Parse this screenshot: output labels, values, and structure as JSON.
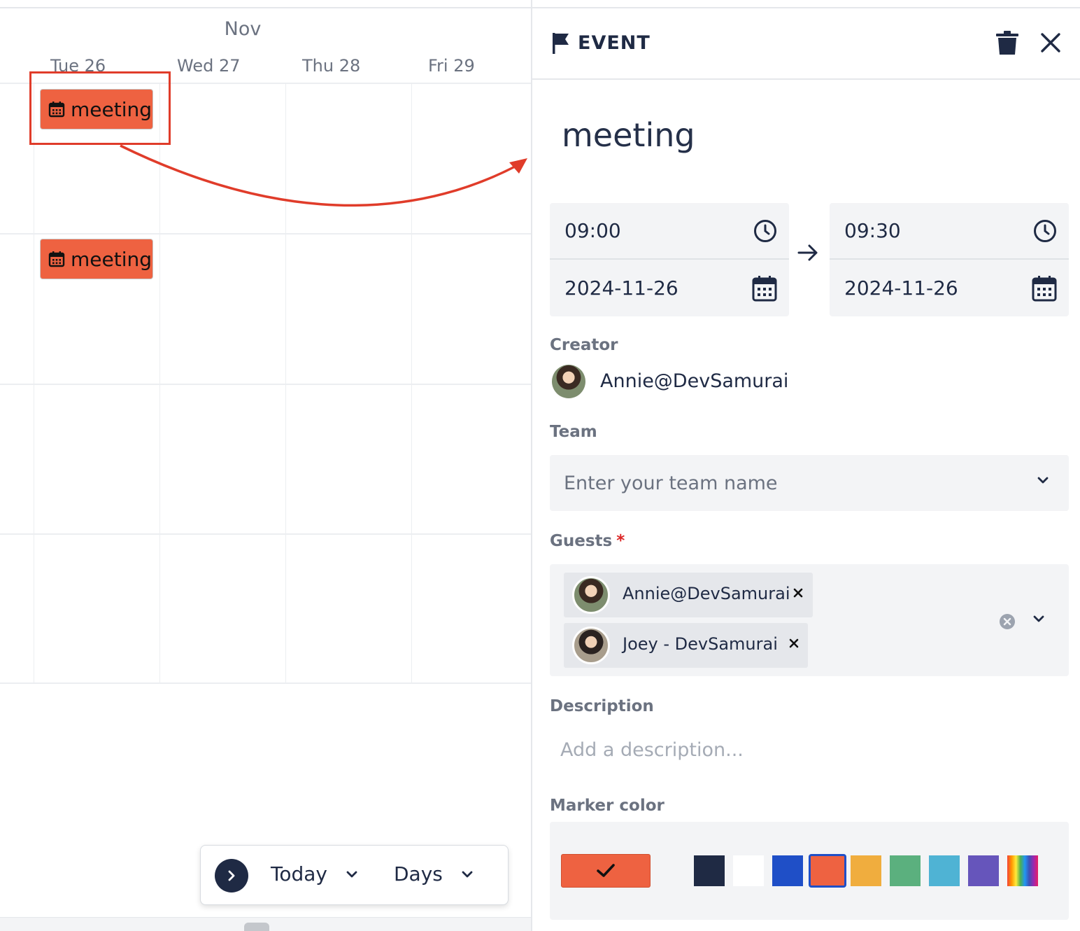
{
  "calendar": {
    "month": "Nov",
    "days": [
      "Tue 26",
      "Wed 27",
      "Thu 28",
      "Fri 29"
    ],
    "events": [
      {
        "label": "meeting"
      },
      {
        "label": "meeting"
      }
    ]
  },
  "toolbar": {
    "today_label": "Today",
    "view_label": "Days"
  },
  "panel": {
    "header_title": "EVENT",
    "event_title": "meeting",
    "start": {
      "time": "09:00",
      "date": "2024-11-26"
    },
    "end": {
      "time": "09:30",
      "date": "2024-11-26"
    },
    "creator_label": "Creator",
    "creator_name": "Annie@DevSamurai",
    "team_label": "Team",
    "team_placeholder": "Enter your team name",
    "guests_label": "Guests",
    "guests_required": "*",
    "guests": [
      {
        "name": "Annie@DevSamurai"
      },
      {
        "name": "Joey - DevSamurai"
      }
    ],
    "description_label": "Description",
    "description_placeholder": "Add a description...",
    "marker_color_label": "Marker color",
    "selected_color": "#ee6241",
    "swatches": [
      "#1f2a44",
      "#ffffff",
      "#1f4fc7",
      "#ee6241",
      "#f0ad3e",
      "#5bb07e",
      "#4fb3d4",
      "#6655bb",
      "rainbow"
    ]
  }
}
